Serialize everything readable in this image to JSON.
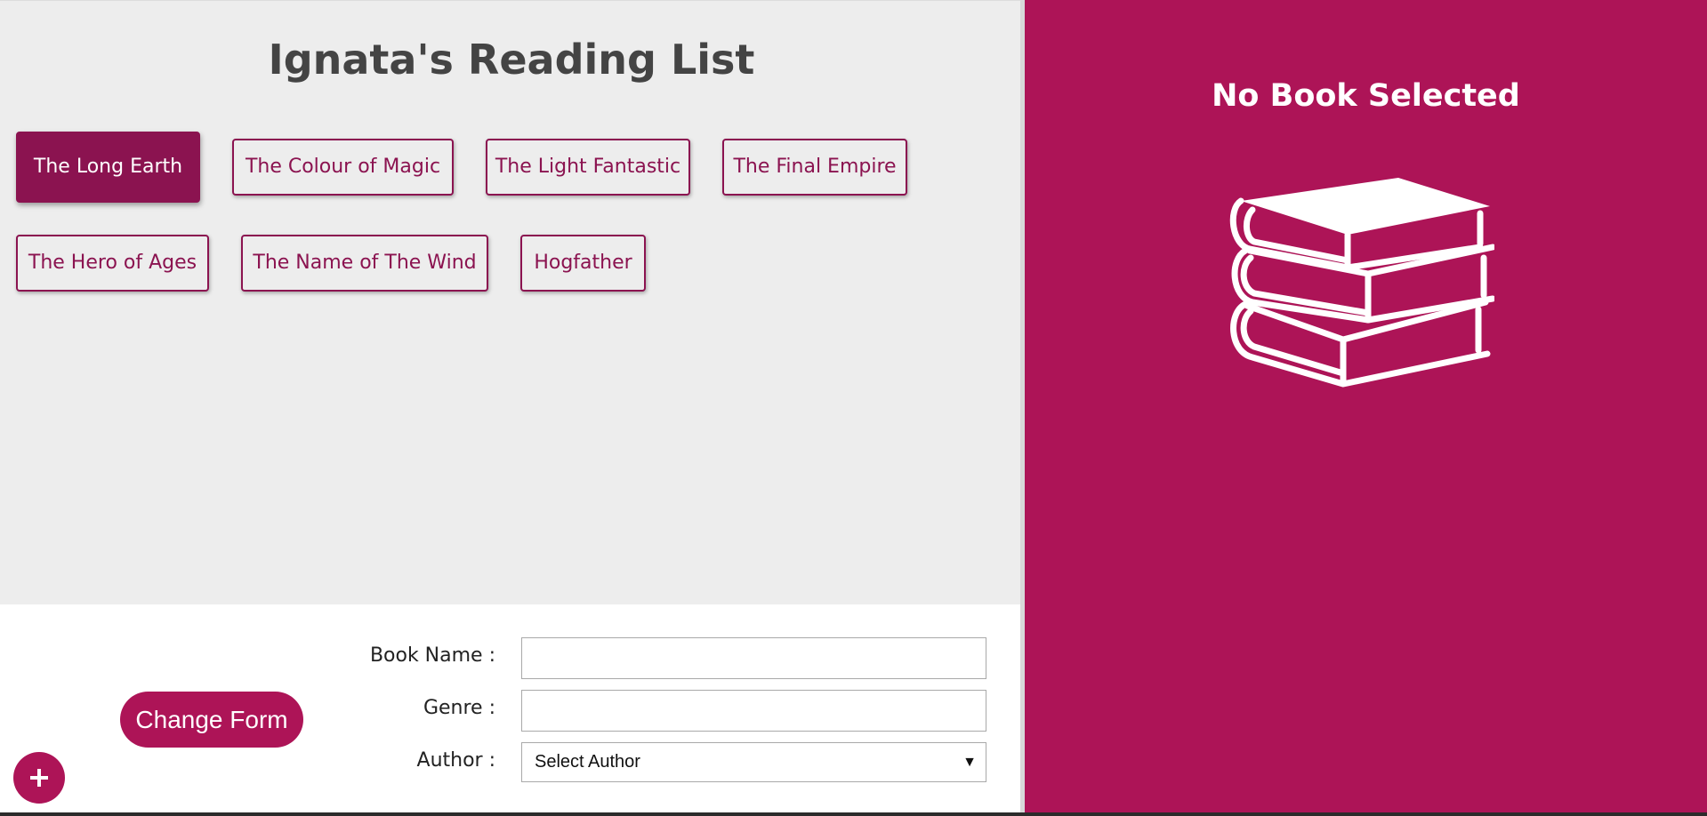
{
  "header": {
    "title": "Ignata's Reading List"
  },
  "books": [
    {
      "label": "The Long Earth",
      "active": true
    },
    {
      "label": "The Colour of Magic",
      "active": false
    },
    {
      "label": "The Light Fantastic",
      "active": false
    },
    {
      "label": "The Final Empire",
      "active": false
    },
    {
      "label": "The Hero of Ages",
      "active": false
    },
    {
      "label": "The Name of The Wind",
      "active": false
    },
    {
      "label": "Hogfather",
      "active": false
    }
  ],
  "form": {
    "book_name_label": "Book Name :",
    "book_name_value": "",
    "genre_label": "Genre :",
    "genre_value": "",
    "author_label": "Author :",
    "author_selected": "Select Author",
    "change_form_label": "Change Form",
    "add_icon": "plus-icon"
  },
  "details": {
    "title": "No Book Selected",
    "icon": "books-stack-icon"
  },
  "colors": {
    "accent": "#ad1457",
    "accent_dark": "#8b1350",
    "list_background": "#ededed",
    "title_text": "#444444"
  }
}
